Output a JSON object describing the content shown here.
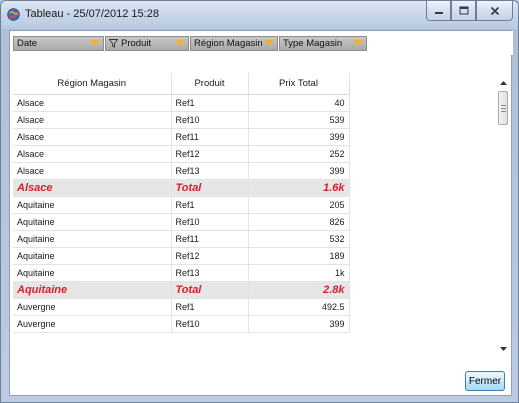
{
  "window": {
    "title": "Tableau - 25/07/2012 15:28",
    "icon": "app-globe-icon"
  },
  "filters": [
    {
      "label": "Date",
      "icon": "",
      "arrow_icon": "dropdown-arrow-icon"
    },
    {
      "label": "Produit",
      "icon": "funnel-icon",
      "arrow_icon": "dropdown-arrow-icon"
    },
    {
      "label": "Région Magasin",
      "icon": "",
      "arrow_icon": "dropdown-arrow-icon"
    },
    {
      "label": "Type Magasin",
      "icon": "",
      "arrow_icon": "dropdown-arrow-icon"
    }
  ],
  "table": {
    "headers": [
      "Région Magasin",
      "Produit",
      "Prix Total"
    ],
    "rows": [
      {
        "region": "Alsace",
        "produit": "Ref1",
        "prix": "40",
        "total": false
      },
      {
        "region": "Alsace",
        "produit": "Ref10",
        "prix": "539",
        "total": false
      },
      {
        "region": "Alsace",
        "produit": "Ref11",
        "prix": "399",
        "total": false
      },
      {
        "region": "Alsace",
        "produit": "Ref12",
        "prix": "252",
        "total": false
      },
      {
        "region": "Alsace",
        "produit": "Ref13",
        "prix": "399",
        "total": false
      },
      {
        "region": "Alsace",
        "produit": "Total",
        "prix": "1.6k",
        "total": true
      },
      {
        "region": "Aquitaine",
        "produit": "Ref1",
        "prix": "205",
        "total": false
      },
      {
        "region": "Aquitaine",
        "produit": "Ref10",
        "prix": "826",
        "total": false
      },
      {
        "region": "Aquitaine",
        "produit": "Ref11",
        "prix": "532",
        "total": false
      },
      {
        "region": "Aquitaine",
        "produit": "Ref12",
        "prix": "189",
        "total": false
      },
      {
        "region": "Aquitaine",
        "produit": "Ref13",
        "prix": "1k",
        "total": false
      },
      {
        "region": "Aquitaine",
        "produit": "Total",
        "prix": "2.8k",
        "total": true
      },
      {
        "region": "Auvergne",
        "produit": "Ref1",
        "prix": "492.5",
        "total": false
      },
      {
        "region": "Auvergne",
        "produit": "Ref10",
        "prix": "399",
        "total": false
      }
    ]
  },
  "buttons": {
    "close_label": "Fermer"
  },
  "colors": {
    "total_text": "#d6202a",
    "total_bg": "#e6e6e6",
    "filter_arrow": "#f2b035"
  }
}
